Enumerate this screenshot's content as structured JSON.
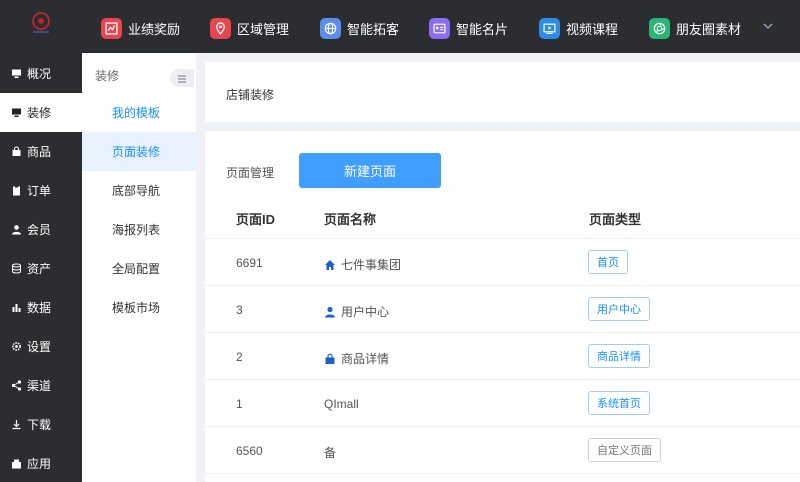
{
  "colors": {
    "dark_bg": "#2b2d31",
    "accent": "#409eff",
    "link": "#1890ff"
  },
  "topnav": [
    {
      "label": "业绩奖励",
      "icon": "chart-icon",
      "color": "#e8454e"
    },
    {
      "label": "区域管理",
      "icon": "location-icon",
      "color": "#e8454e"
    },
    {
      "label": "智能拓客",
      "icon": "globe-icon",
      "color": "#5b8def"
    },
    {
      "label": "智能名片",
      "icon": "card-icon",
      "color": "#8c6cf0"
    },
    {
      "label": "视频课程",
      "icon": "video-icon",
      "color": "#2d8ce6"
    },
    {
      "label": "朋友圈素材",
      "icon": "aperture-icon",
      "color": "#2bb673"
    }
  ],
  "sidebar": [
    {
      "label": "概况",
      "icon": "monitor-icon"
    },
    {
      "label": "装修",
      "icon": "monitor-icon"
    },
    {
      "label": "商品",
      "icon": "bag-icon"
    },
    {
      "label": "订单",
      "icon": "clipboard-icon"
    },
    {
      "label": "会员",
      "icon": "user-icon"
    },
    {
      "label": "资产",
      "icon": "database-icon"
    },
    {
      "label": "数据",
      "icon": "bar-chart-icon"
    },
    {
      "label": "设置",
      "icon": "gear-icon"
    },
    {
      "label": "渠道",
      "icon": "share-icon"
    },
    {
      "label": "下载",
      "icon": "download-icon"
    },
    {
      "label": "应用",
      "icon": "apps-icon"
    }
  ],
  "submenu": {
    "title": "装修",
    "items": [
      {
        "label": "我的模板"
      },
      {
        "label": "页面装修"
      },
      {
        "label": "底部导航"
      },
      {
        "label": "海报列表"
      },
      {
        "label": "全局配置"
      },
      {
        "label": "模板市场"
      }
    ]
  },
  "header": {
    "breadcrumb": "店铺装修"
  },
  "page_mgmt": {
    "label": "页面管理",
    "new_button": "新建页面"
  },
  "table": {
    "columns": [
      "页面ID",
      "页面名称",
      "页面类型"
    ],
    "rows": [
      {
        "id": "6691",
        "name": "七件事集团",
        "icon": "home-icon",
        "type": "首页"
      },
      {
        "id": "3",
        "name": "用户中心",
        "icon": "user-icon",
        "type": "用户中心"
      },
      {
        "id": "2",
        "name": "商品详情",
        "icon": "bag-icon",
        "type": "商品详情"
      },
      {
        "id": "1",
        "name": "QImall",
        "icon": "",
        "type": "系统首页"
      },
      {
        "id": "6560",
        "name": "备",
        "icon": "",
        "type": "自定义页面"
      }
    ]
  }
}
